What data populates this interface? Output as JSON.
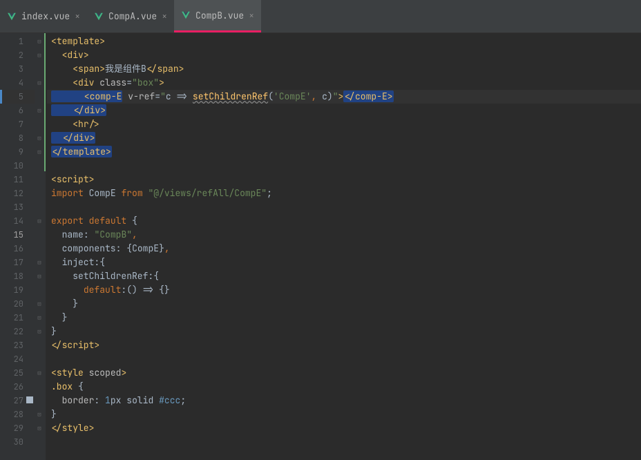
{
  "tabs": [
    {
      "label": "index.vue",
      "active": false
    },
    {
      "label": "CompA.vue",
      "active": false
    },
    {
      "label": "CompB.vue",
      "active": true
    }
  ],
  "line_numbers": [
    "1",
    "2",
    "3",
    "4",
    "5",
    "6",
    "7",
    "8",
    "9",
    "10",
    "11",
    "12",
    "13",
    "14",
    "15",
    "16",
    "17",
    "18",
    "19",
    "20",
    "21",
    "22",
    "23",
    "24",
    "25",
    "26",
    "27",
    "28",
    "29",
    "30"
  ],
  "active_line": 5,
  "breakpoint_line": 27,
  "code": {
    "l1": {
      "pre": "<",
      "tag": "template",
      "post": ">"
    },
    "l2": {
      "pre": "  <",
      "tag": "div",
      "post": ">"
    },
    "l3": {
      "pre": "    <",
      "tag1": "span",
      "mid": ">",
      "txt": "我是组件B",
      "close": "</",
      "tag2": "span",
      "post": ">"
    },
    "l4": {
      "pre": "    <",
      "tag": "div",
      "sp": " ",
      "attr": "class",
      "eq": "=",
      "val": "\"box\"",
      "post": ">"
    },
    "l5": {
      "pre": "      <",
      "tag": "comp-E",
      "sp": " ",
      "attr": "v-ref",
      "eq": "=",
      "q1": "\"",
      "arg": "c => ",
      "fn": "setChildrenRef",
      "lp": "(",
      "s": "'CompE'",
      "cm": ",",
      "arg2": " c)",
      "q2": "\"",
      "mid": ">",
      "close": "</",
      "tag2": "comp-E",
      "post": ">"
    },
    "l6": {
      "pre": "    </",
      "tag": "div",
      "post": ">"
    },
    "l7": {
      "pre": "    <",
      "tag": "hr",
      "post": "/>"
    },
    "l8": {
      "pre": "  </",
      "tag": "div",
      "post": ">"
    },
    "l9": {
      "pre": "</",
      "tag": "template",
      "post": ">"
    },
    "l11": {
      "pre": "<",
      "tag": "script",
      "post": ">"
    },
    "l12": {
      "kw1": "import",
      "sp1": " ",
      "id": "CompE",
      "sp2": " ",
      "kw2": "from",
      "sp3": " ",
      "str": "\"@/views/refAll/CompE\"",
      "sc": ";"
    },
    "l14": {
      "kw1": "export",
      "sp1": " ",
      "kw2": "default",
      "sp2": " ",
      "br": "{"
    },
    "l15": {
      "pre": "  ",
      "id": "name",
      "col": ":",
      "sp": " ",
      "str": "\"CompB\"",
      "cm": ","
    },
    "l16": {
      "pre": "  ",
      "id": "components",
      "col": ":",
      "sp": " ",
      "br1": "{",
      "id2": "CompE",
      "br2": "}",
      "cm": ","
    },
    "l17": {
      "pre": "  ",
      "id": "inject",
      "col": ":",
      "br": "{"
    },
    "l18": {
      "pre": "    ",
      "id": "setChildrenRef",
      "col": ":",
      "br": "{"
    },
    "l19": {
      "pre": "      ",
      "id": "default",
      "col": ":",
      "fn": "() => ",
      "br": "{}"
    },
    "l20": {
      "pre": "    ",
      "br": "}"
    },
    "l21": {
      "pre": "  ",
      "br": "}"
    },
    "l22": {
      "br": "}"
    },
    "l23": {
      "pre": "</",
      "tag": "script",
      "post": ">"
    },
    "l25": {
      "pre": "<",
      "tag": "style",
      "sp": " ",
      "attr": "scoped",
      "post": ">"
    },
    "l26": {
      "sel": ".box",
      "sp": " ",
      "br": "{"
    },
    "l27": {
      "pre": "  ",
      "prop": "border",
      "col": ":",
      "sp": " ",
      "num": "1",
      "unit": "px",
      "sp2": " ",
      "val": "solid",
      "sp3": " ",
      "hex": "#ccc",
      "sc": ";"
    },
    "l28": {
      "br": "}"
    },
    "l29": {
      "pre": "</",
      "tag": "style",
      "post": ">"
    }
  }
}
